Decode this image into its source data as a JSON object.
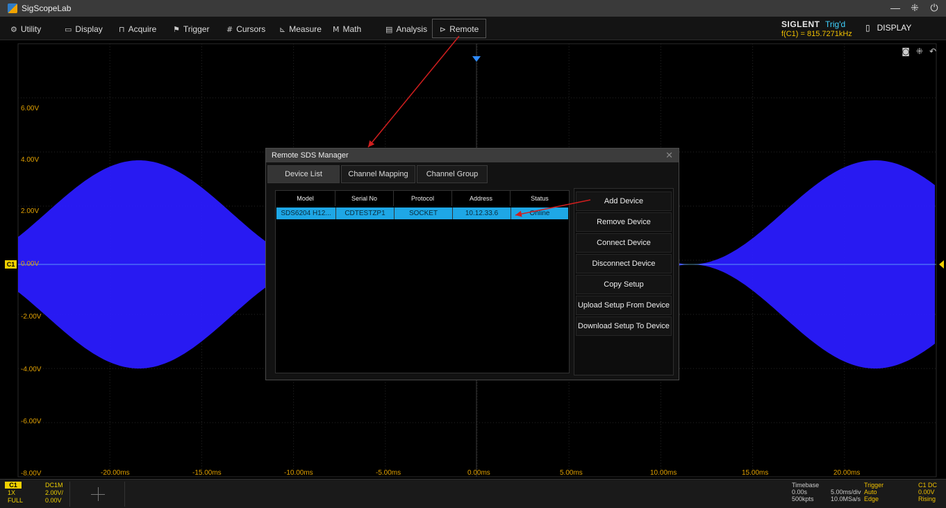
{
  "window": {
    "title": "SigScopeLab"
  },
  "menu": {
    "items": [
      {
        "label": "Utility",
        "icon": "⚙"
      },
      {
        "label": "Display",
        "icon": "▭"
      },
      {
        "label": "Acquire",
        "icon": "⊓"
      },
      {
        "label": "Trigger",
        "icon": "⚑"
      },
      {
        "label": "Cursors",
        "icon": "#"
      },
      {
        "label": "Measure",
        "icon": "⊾"
      },
      {
        "label": "Math",
        "icon": "M"
      },
      {
        "label": "Analysis",
        "icon": "▤"
      },
      {
        "label": "Remote",
        "icon": "⊳"
      }
    ]
  },
  "status": {
    "brand": "SIGLENT",
    "trig_state": "Trig'd",
    "frequency": "f(C1) = 815.7271kHz",
    "display_label": "DISPLAY",
    "colors": {
      "trig_state": "#3fd1ff",
      "frequency": "#f0c000"
    }
  },
  "plot": {
    "y_labels": [
      "6.00V",
      "4.00V",
      "2.00V",
      "0.00V",
      "-2.00V",
      "-4.00V",
      "-6.00V",
      "-8.00V"
    ],
    "x_labels": [
      "-20.00ms",
      "-15.00ms",
      "-10.00ms",
      "-5.00ms",
      "0.00ms",
      "5.00ms",
      "10.00ms",
      "15.00ms",
      "20.00ms"
    ],
    "channel_marker": "C1",
    "waveform_color": "#2a1bff"
  },
  "dialog": {
    "title": "Remote SDS Manager",
    "close": "✕",
    "tabs": [
      "Device List",
      "Channel Mapping",
      "Channel Group"
    ],
    "active_tab": "Device List",
    "columns": [
      "Model",
      "Serial No",
      "Protocol",
      "Address",
      "Status"
    ],
    "rows": [
      {
        "model": "SDS6204 H12...",
        "serial": "CDTESTZP1",
        "protocol": "SOCKET",
        "address": "10.12.33.6",
        "status": "Online"
      }
    ],
    "buttons": [
      "Add Device",
      "Remove Device",
      "Connect Device",
      "Disconnect Device",
      "Copy Setup",
      "Upload Setup From Device",
      "Download Setup To Device"
    ]
  },
  "bottom": {
    "channel": {
      "name": "C1",
      "coupling": "DC1M",
      "probe": "1X",
      "scale": "2.00V/",
      "bandwidth": "FULL",
      "offset": "0.00V"
    },
    "timebase": {
      "title": "Timebase",
      "delay": "0.00s",
      "scale": "5.00ms/div",
      "depth": "500kpts",
      "rate": "10.0MSa/s"
    },
    "trigger": {
      "title": "Trigger",
      "mode": "Auto",
      "type": "Edge",
      "source": "C1 DC",
      "level": "0.00V",
      "slope": "Rising"
    }
  }
}
